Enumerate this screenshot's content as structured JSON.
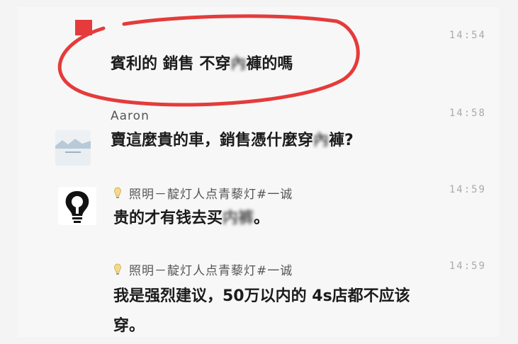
{
  "messages": [
    {
      "author": "",
      "time": "14:54",
      "text_a": "賓利的 銷售 不穿",
      "text_blur": "內",
      "text_b": "褲的嗎"
    },
    {
      "author": "Aaron",
      "time": "14:58",
      "text_a": "賣這麼貴的車，銷售憑什麼穿",
      "text_blur": "內",
      "text_b": "褲?"
    },
    {
      "author": "照明－靛灯人点青藜灯#一诚",
      "time": "14:59",
      "text_a": "贵的才有钱去买",
      "text_blur": "内裤",
      "text_b": "。"
    },
    {
      "author": "照明－靛灯人点青藜灯#一诚",
      "time": "14:59",
      "line1": "我是强烈建议，50万以内的 4s店都不应该",
      "line2": "穿。"
    }
  ],
  "colors": {
    "highlight": "#e53b3b"
  }
}
